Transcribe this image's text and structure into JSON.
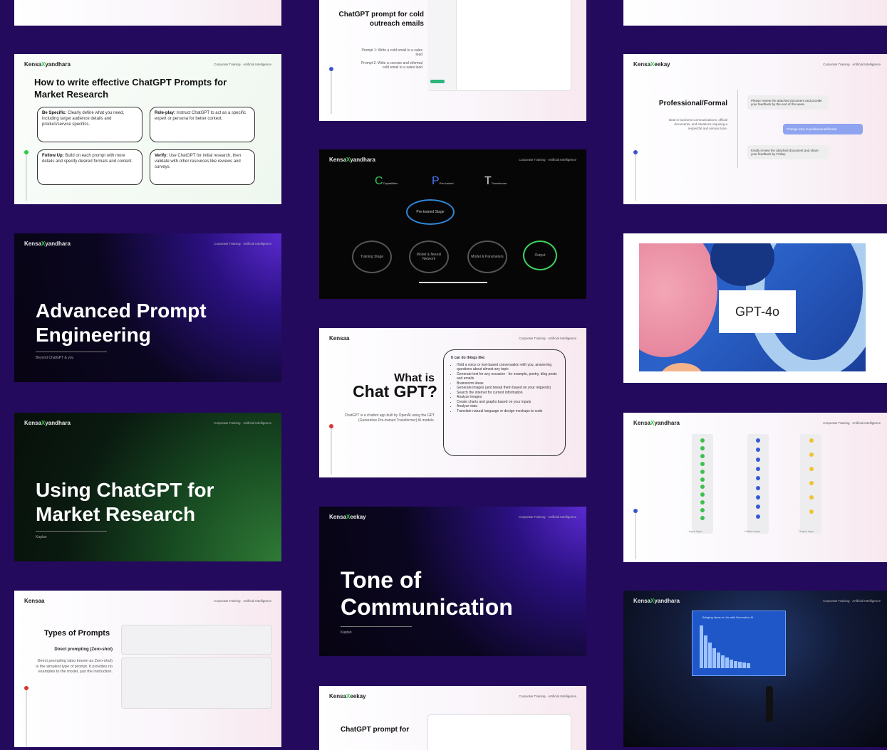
{
  "brand": {
    "logo_a": "Kensa",
    "logo_x": "X",
    "logo_b": "yandhara",
    "logo_short": "Kensaa",
    "logo_b2": "eekay"
  },
  "tagline": "Corporate Training · Artificial Intelligence",
  "col1": {
    "s2": {
      "title": "How to write effective ChatGPT Prompts for Market Research",
      "boxes": [
        {
          "head": "Be Specific:",
          "text": "Clearly define what you need, including target audience details and product/service specifics."
        },
        {
          "head": "Role-play:",
          "text": "Instruct ChatGPT to act as a specific expert or persona for better context."
        },
        {
          "head": "Follow Up:",
          "text": "Build on each prompt with more details and specify desired formats and content."
        },
        {
          "head": "Verify:",
          "text": "Use ChatGPT for initial research, then validate with other resources like reviews and surveys."
        }
      ]
    },
    "s3": {
      "title": "Advanced Prompt Engineering",
      "sub": "Beyond ChatGPT & you"
    },
    "s4": {
      "title": "Using ChatGPT for Market Research",
      "sub": "Kaplan"
    },
    "s5": {
      "title": "Types of Prompts",
      "sub": "Direct prompting (Zero-shot)",
      "desc": "Direct prompting (also known as Zero-shot) is the simplest type of prompt. It provides no examples to the model, just the instruction."
    }
  },
  "col2": {
    "s1": {
      "title": "ChatGPT prompt for cold outreach emails",
      "p1": "Prompt 1: Write a cold email to a sales lead",
      "p2": "Prompt 2: Write a concise and informal cold email to a sales lead"
    },
    "s2": {
      "letters": [
        "C",
        "P",
        "T"
      ],
      "labels": [
        "Capabilities",
        "Pre-trained",
        "Transformer"
      ],
      "center": "Pre-trained Stage",
      "nodes": [
        "Training Stage",
        "Model & Neural Network",
        "Model & Parameters",
        "Output"
      ]
    },
    "s3": {
      "title_a": "What is",
      "title_b": "Chat GPT?",
      "desc": "ChatGPT is a chatbot app built by OpenAI using the GPT (Generative Pre-trained Transformer) AI models.",
      "list_head": "It can do things like:",
      "list": [
        "Hold a voice or text-based conversation with you, answering questions about almost any topic",
        "Generate text for any occasion - for example, poetry, blog posts and emails",
        "Brainstorm ideas",
        "Generate images (and tweak them based on your requests)",
        "Search the internet for current information",
        "Analyze images",
        "Create charts and graphs based on your inputs",
        "Analyze data",
        "Translate natural language or design mockups to code"
      ]
    },
    "s4": {
      "title": "Tone of Communication",
      "sub": "Kaplan"
    },
    "s5": {
      "title": "ChatGPT prompt for"
    }
  },
  "col3": {
    "s2": {
      "title": "Professional/Formal",
      "desc": "Ideal in business communications, official documents, and situations requiring a respectful and serious tone.",
      "bubble1": "Please review the attached document and provide your feedback by the end of the week.",
      "bubble2": "Change tone to professional/formal",
      "bubble3": "Kindly review the attached document and share your feedback by Friday."
    },
    "s3": {
      "label": "GPT-4o"
    },
    "s4": {
      "labels": [
        "Input layer",
        "Hidden layer",
        "Output layer"
      ]
    },
    "s5": {
      "title": "Bringing Ideas to Life with Generative AI"
    }
  },
  "colors": {
    "bg": "#230a5c",
    "accent_green": "#2ecc40",
    "dot_red": "#d93636",
    "dot_blue": "#3b55c9"
  }
}
